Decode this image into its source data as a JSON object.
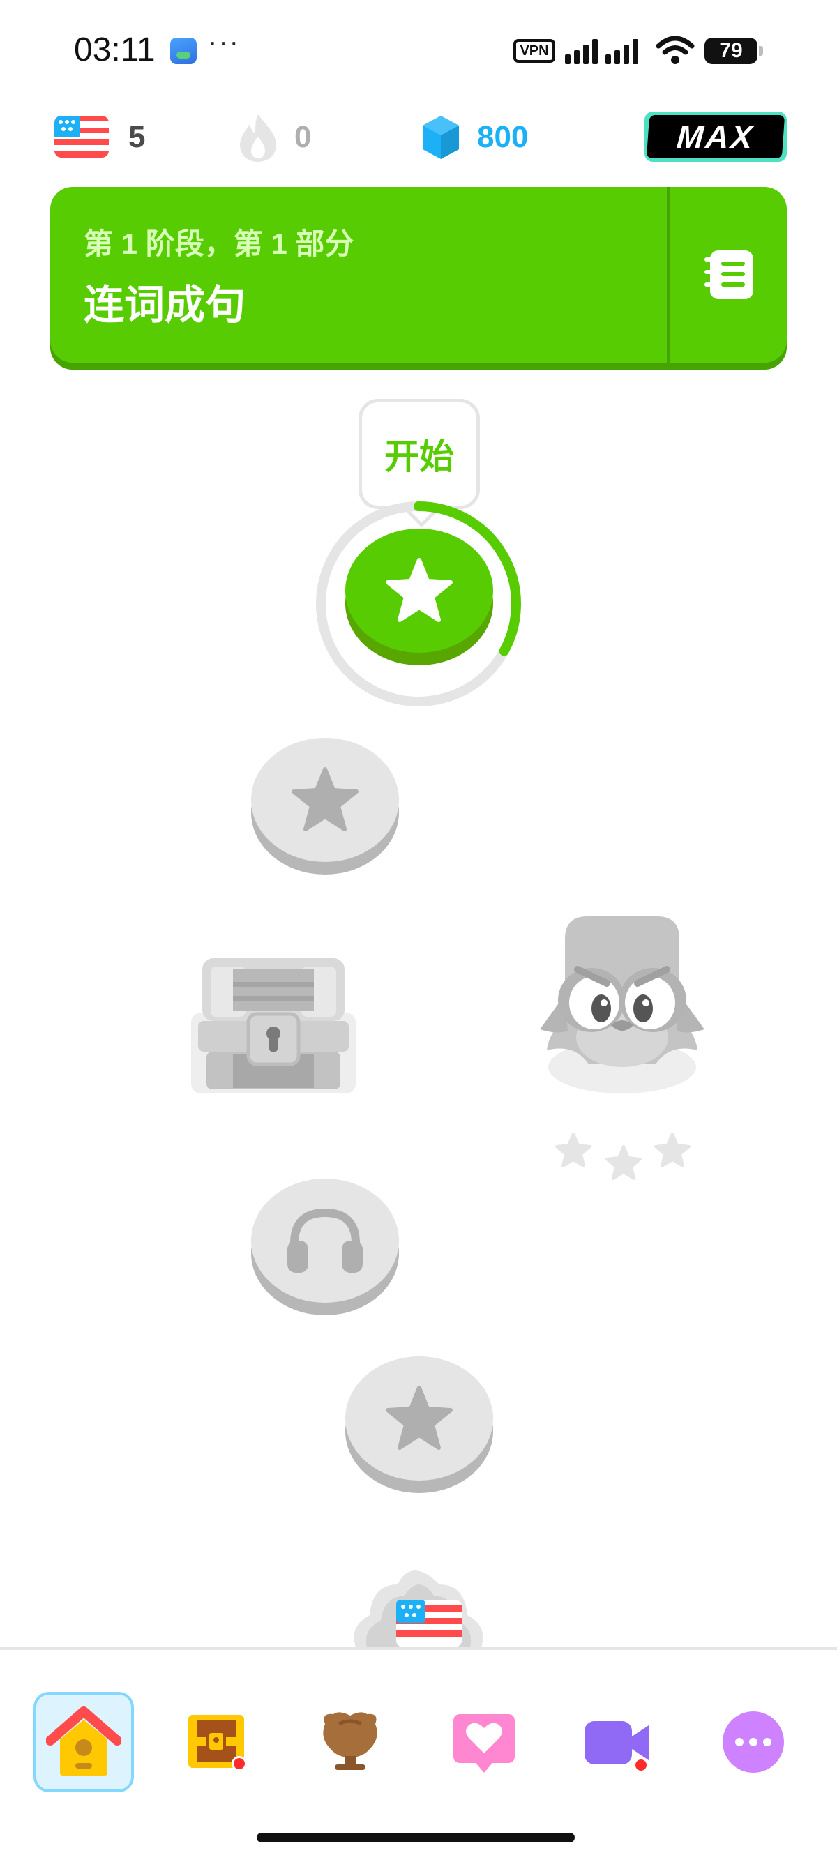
{
  "status_bar": {
    "time": "03:11",
    "more": "···",
    "vpn": "VPN",
    "battery": "79"
  },
  "stats": {
    "course_flag": "us-flag-icon",
    "course_count": "5",
    "streak_count": "0",
    "gems": "800",
    "max_badge": "MAX"
  },
  "unit": {
    "subtitle": "第 1 阶段，第 1 部分",
    "title": "连词成句",
    "guidebook_icon": "guidebook-icon"
  },
  "path": {
    "start_label": "开始",
    "current_lesson_progress": 0.33,
    "nodes": [
      {
        "icon": "star-icon",
        "state": "active"
      },
      {
        "icon": "star-icon",
        "state": "locked"
      },
      {
        "icon": "treasure-chest",
        "state": "locked"
      },
      {
        "icon": "headphones-icon",
        "state": "locked"
      },
      {
        "icon": "star-icon",
        "state": "locked"
      },
      {
        "icon": "checkpoint-flag",
        "state": "locked"
      }
    ],
    "owl_stars": 3
  },
  "nav": {
    "items": [
      {
        "icon": "home-icon",
        "active": true
      },
      {
        "icon": "treasure-icon",
        "badge": true
      },
      {
        "icon": "leaderboard-icon"
      },
      {
        "icon": "hearts-icon"
      },
      {
        "icon": "video-call-icon",
        "badge": true
      },
      {
        "icon": "more-icon"
      }
    ]
  },
  "colors": {
    "green": "#58cc02",
    "green_dark": "#46a302",
    "locked": "#e5e5e5",
    "locked_dark": "#b7b7b7",
    "blue": "#1cb0f6"
  }
}
